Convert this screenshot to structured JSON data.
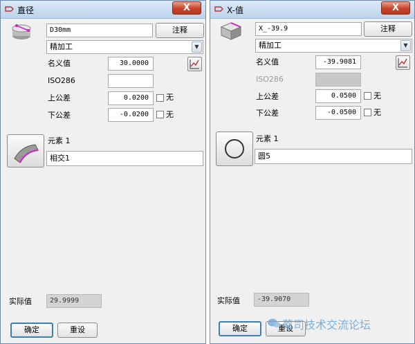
{
  "colors": {
    "titlebar": "#c9dcf1",
    "close": "#c7432a",
    "accent_magenta": "#d020c0",
    "default_border": "#3c7fb1",
    "watermark": "#6fa8d8"
  },
  "window1": {
    "title": "直径",
    "close_label": "X",
    "name_value": "D30mm",
    "comment_button": "注释",
    "operation_select": "精加工",
    "nominal_label": "名义值",
    "nominal_value": "30.0000",
    "iso_label": "ISO286",
    "iso_value": "",
    "upper_tol_label": "上公差",
    "upper_tol_value": "0.0200",
    "upper_none_label": "无",
    "lower_tol_label": "下公差",
    "lower_tol_value": "-0.0200",
    "lower_none_label": "无",
    "element_label": "元素 1",
    "element_value": "相交1",
    "element_icon": "intersection-icon",
    "actual_label": "实际值",
    "actual_value": "29.9999",
    "ok_button": "确定",
    "reset_button": "重设"
  },
  "window2": {
    "title": "X-值",
    "close_label": "X",
    "name_value": "X_-39.9",
    "comment_button": "注释",
    "operation_select": "精加工",
    "nominal_label": "名义值",
    "nominal_value": "-39.9081",
    "iso_label": "ISO286",
    "upper_tol_label": "上公差",
    "upper_tol_value": "0.0500",
    "upper_none_label": "无",
    "lower_tol_label": "下公差",
    "lower_tol_value": "-0.0500",
    "lower_none_label": "无",
    "element_label": "元素 1",
    "element_value": "圆5",
    "element_icon": "circle-icon",
    "actual_label": "实际值",
    "actual_value": "-39.9070",
    "ok_button": "确定",
    "reset_button": "重设"
  },
  "watermark": "蔡司技术交流论坛"
}
